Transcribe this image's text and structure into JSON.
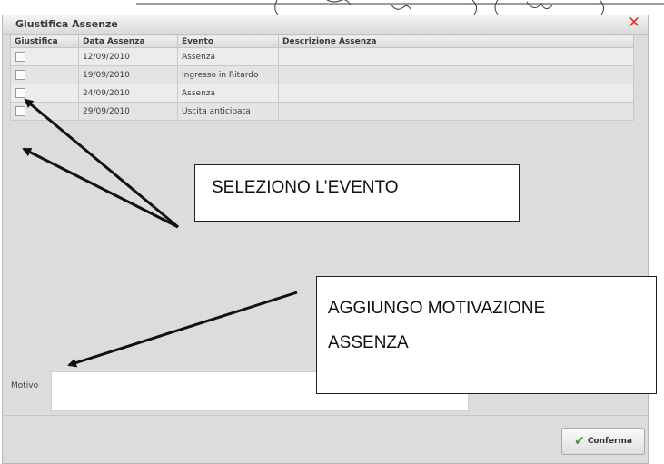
{
  "dialog": {
    "title": "Giustifica Assenze",
    "close_symbol": "✕"
  },
  "table": {
    "headers": [
      "Giustifica",
      "Data Assenza",
      "Evento",
      "Descrizione Assenza"
    ],
    "rows": [
      {
        "date": "12/09/2010",
        "event": "Assenza",
        "description": ""
      },
      {
        "date": "19/09/2010",
        "event": "Ingresso in Ritardo",
        "description": ""
      },
      {
        "date": "24/09/2010",
        "event": "Assenza",
        "description": ""
      },
      {
        "date": "29/09/2010",
        "event": "Uscita anticipata",
        "description": ""
      }
    ]
  },
  "motivo": {
    "label": "Motivo",
    "value": ""
  },
  "confirm_button": {
    "label": "Conferma"
  },
  "annotations": {
    "select_event": "SELEZIONO L’EVENTO",
    "add_reason_line1": "AGGIUNGO MOTIVAZIONE",
    "add_reason_line2": "ASSENZA"
  },
  "colors": {
    "close": "#d33b2c",
    "check": "#3aa02c"
  }
}
